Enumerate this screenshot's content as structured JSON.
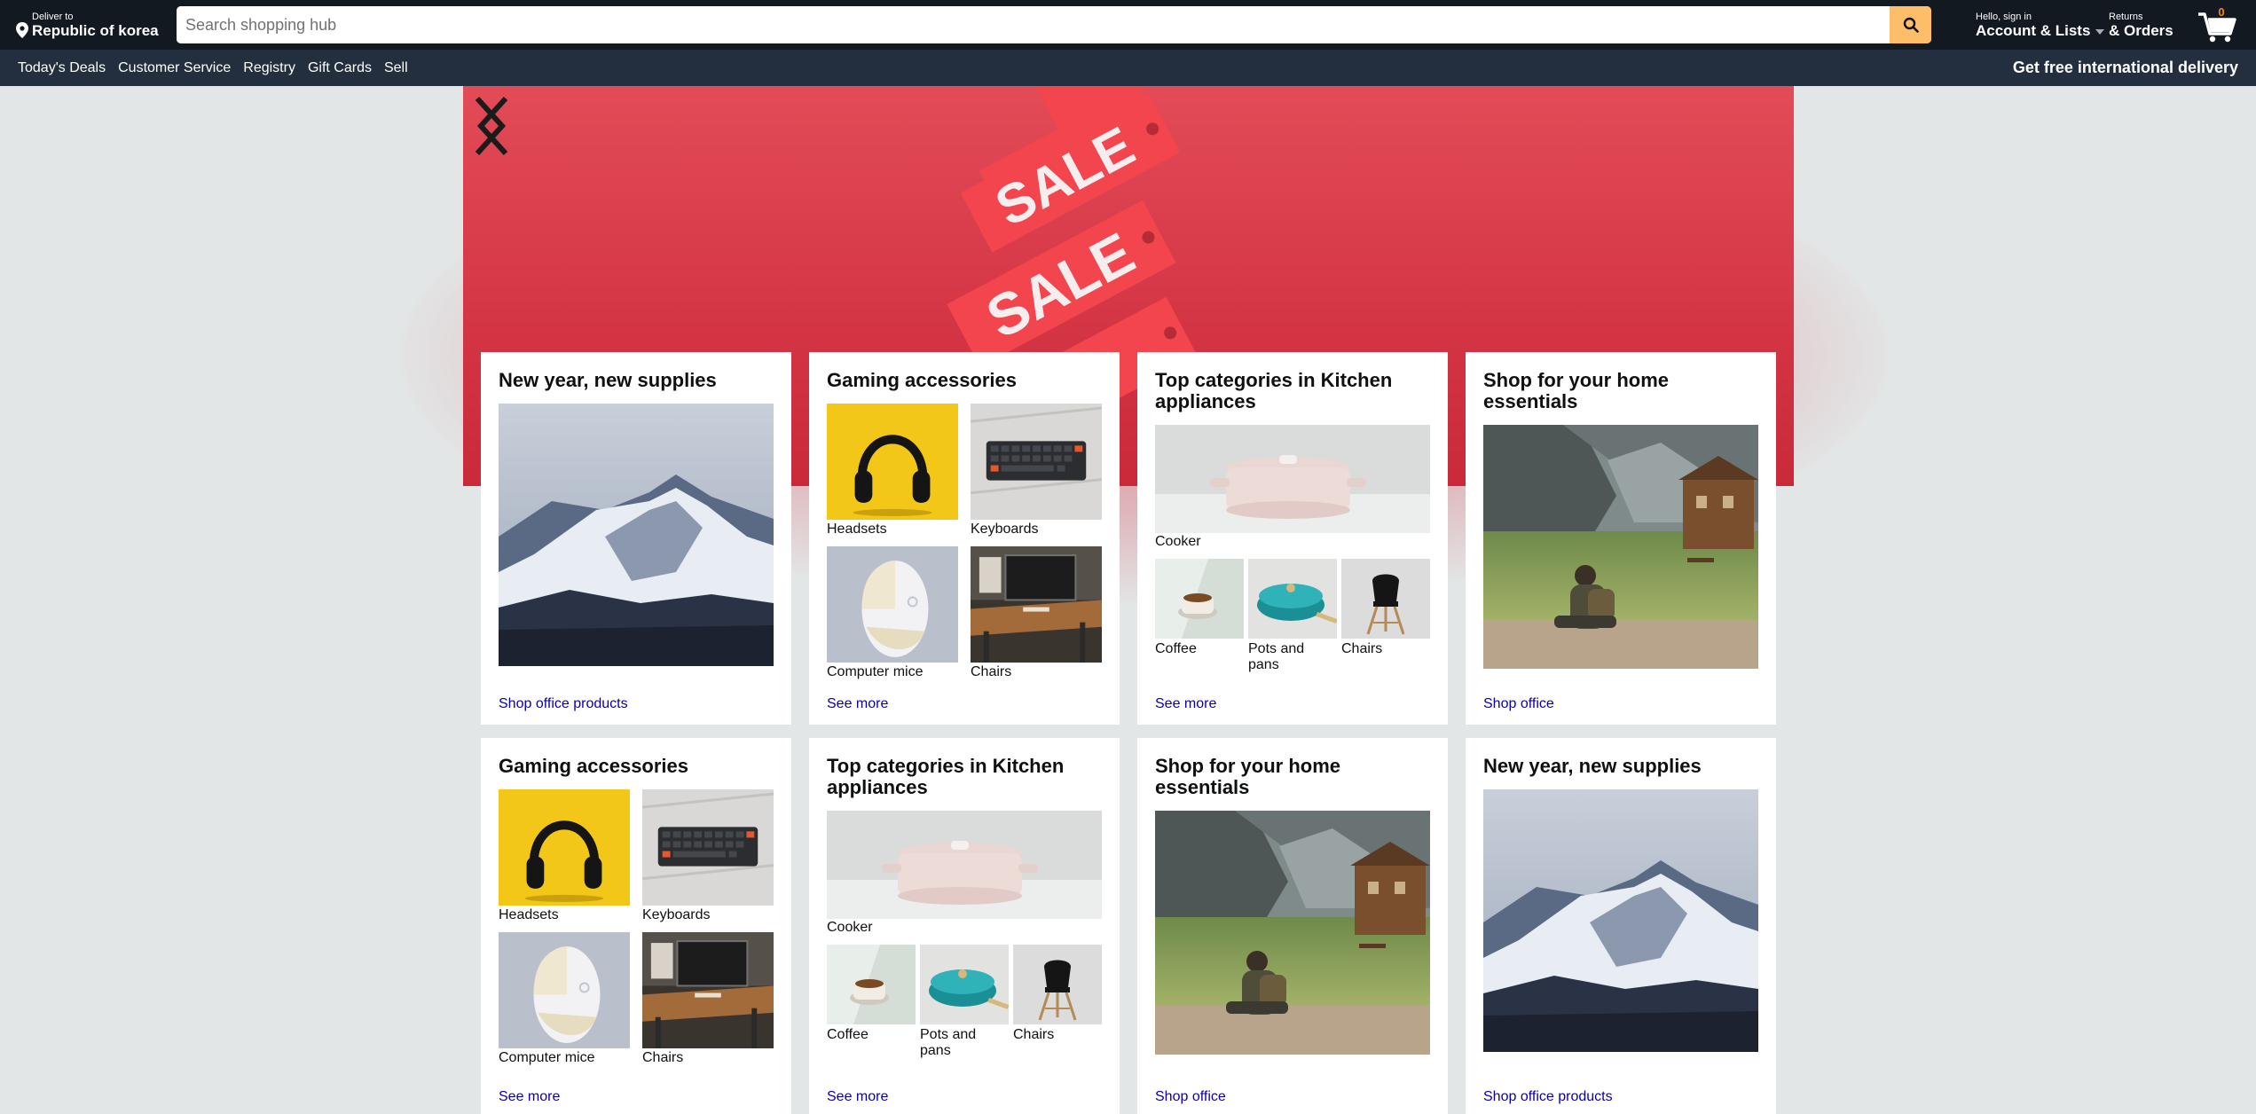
{
  "nav": {
    "deliver_small": "Deliver to",
    "deliver_location": "Republic of korea",
    "search_placeholder": "Search shopping hub",
    "account_small": "Hello, sign in",
    "account_big": "Account & Lists",
    "orders_small": "Returns",
    "orders_big": "& Orders",
    "cart_count": "0"
  },
  "subnav": {
    "links": [
      "Today's Deals",
      "Customer Service",
      "Registry",
      "Gift Cards",
      "Sell"
    ],
    "promo": "Get free international delivery"
  },
  "hero": {
    "tag_text": "SALE"
  },
  "cards": [
    {
      "title": "New year, new supplies",
      "image": "mountain",
      "link": "Shop office products"
    },
    {
      "title": "Gaming accessories",
      "items": [
        "Headsets",
        "Keyboards",
        "Computer mice",
        "Chairs"
      ],
      "link": "See more"
    },
    {
      "title": "Top categories in Kitchen appliances",
      "main_item": "Cooker",
      "items": [
        "Coffee",
        "Pots and pans",
        "Chairs"
      ],
      "link": "See more"
    },
    {
      "title": "Shop for your home essentials",
      "image": "lake-hiker",
      "link": "Shop office"
    },
    {
      "title": "Gaming accessories",
      "items": [
        "Headsets",
        "Keyboards",
        "Computer mice",
        "Chairs"
      ],
      "link": "See more"
    },
    {
      "title": "Top categories in Kitchen appliances",
      "main_item": "Cooker",
      "items": [
        "Coffee",
        "Pots and pans",
        "Chairs"
      ],
      "link": "See more"
    },
    {
      "title": "Shop for your home essentials",
      "image": "lake-hiker",
      "link": "Shop office"
    },
    {
      "title": "New year, new supplies",
      "image": "mountain",
      "link": "Shop office products"
    }
  ],
  "colors": {
    "nav_bg": "#131921",
    "subnav_bg": "#232f3e",
    "search_button": "#febd69",
    "link": "#0c00a8",
    "hero_red": "#d43544"
  }
}
